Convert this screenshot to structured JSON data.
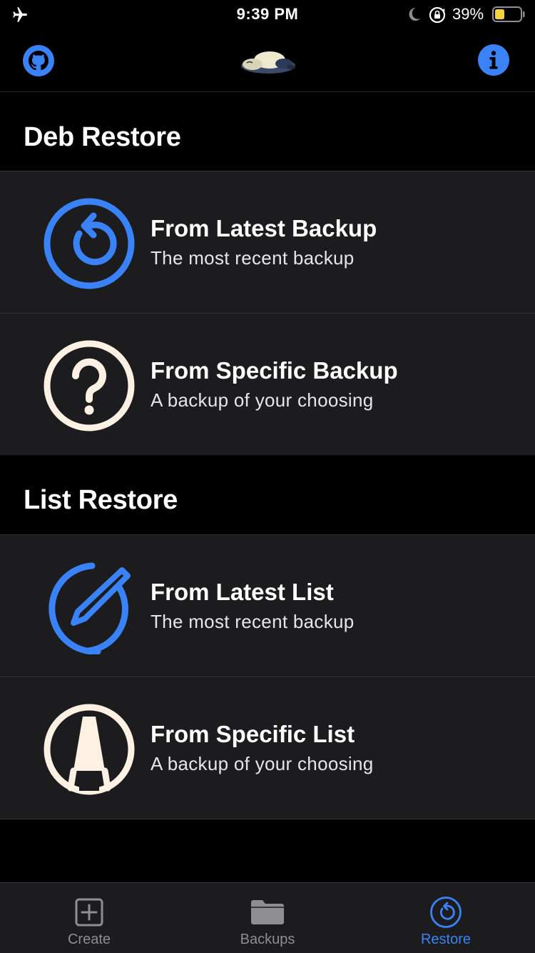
{
  "status_bar": {
    "time": "9:39 PM",
    "battery_percent": "39%",
    "battery_level": 0.39,
    "icons": [
      "airplane-icon",
      "moon-icon",
      "orientation-lock-icon",
      "battery-icon"
    ]
  },
  "nav_bar": {
    "left_icon": "github-icon",
    "center_icon": "mascot-logo",
    "right_icon": "info-icon"
  },
  "sections": [
    {
      "header": "Deb Restore",
      "rows": [
        {
          "title": "From Latest Backup",
          "subtitle": "The most recent backup",
          "icon": "restore-icon",
          "icon_color": "#3a82f7"
        },
        {
          "title": "From Specific Backup",
          "subtitle": "A backup of your choosing",
          "icon": "question-icon",
          "icon_color": "#fcf1e2"
        }
      ]
    },
    {
      "header": "List Restore",
      "rows": [
        {
          "title": "From Latest List",
          "subtitle": "The most recent backup",
          "icon": "pencil-circle-icon",
          "icon_color": "#3a82f7"
        },
        {
          "title": "From Specific List",
          "subtitle": "A backup of your choosing",
          "icon": "pen-nib-icon",
          "icon_color": "#fcf1e2"
        }
      ]
    }
  ],
  "tab_bar": {
    "tabs": [
      {
        "label": "Create",
        "icon": "plus-square-icon",
        "active": false
      },
      {
        "label": "Backups",
        "icon": "folder-icon",
        "active": false
      },
      {
        "label": "Restore",
        "icon": "restore-icon",
        "active": true
      }
    ]
  },
  "colors": {
    "accent": "#3a82f7",
    "cream": "#fcf1e2",
    "row_background": "#1c1c1e",
    "background": "#000000",
    "inactive_tab": "#8e8e93"
  }
}
